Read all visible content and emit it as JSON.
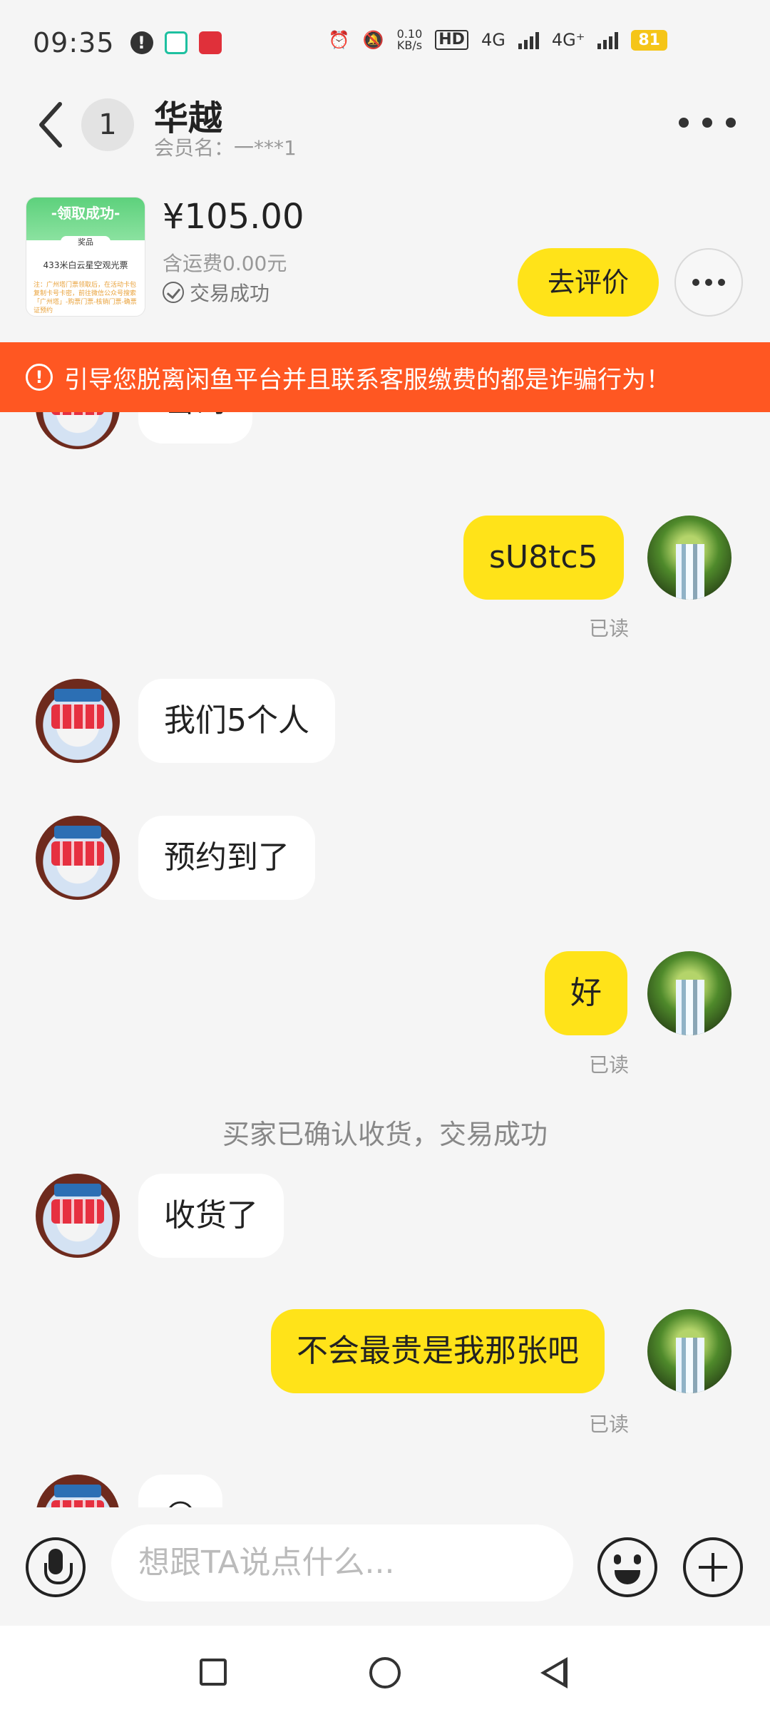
{
  "status_bar": {
    "time": "09:35",
    "net_speed": "0.10",
    "net_speed_unit": "KB/s",
    "hd_label": "HD",
    "sim1_label": "4G",
    "sim2_label": "4G⁺",
    "battery": "81"
  },
  "header": {
    "back_icon": "chevron-left-icon",
    "unread_count": "1",
    "title": "华越",
    "subtitle": "会员名：一***1",
    "more_icon": "more-dots-icon"
  },
  "product": {
    "thumb_banner": "-领取成功-",
    "thumb_tag": "奖品",
    "thumb_text": "433米白云星空观光票",
    "thumb_footer": "注：广州塔门票领取后，在活动卡包复制卡号卡密，前往微信公众号搜索「广州塔」-购票门票-核销门票-确票证预约",
    "price": "¥105.00",
    "shipping": "含运费0.00元",
    "status": "交易成功",
    "review_button": "去评价"
  },
  "warning": {
    "text": "引导您脱离闲鱼平台并且联系客服缴费的都是诈骗行为！"
  },
  "messages": [
    {
      "from": "seller",
      "text": "密码"
    },
    {
      "from": "me",
      "text": "sU8tc5",
      "status": "已读"
    },
    {
      "from": "seller",
      "text": "我们5个人"
    },
    {
      "from": "seller",
      "text": "预约到了"
    },
    {
      "from": "me",
      "text": "好",
      "status": "已读"
    },
    {
      "system": "买家已确认收货，交易成功"
    },
    {
      "from": "seller",
      "text": "收货了"
    },
    {
      "from": "me",
      "text": "不会最贵是我那张吧",
      "status": "已读"
    },
    {
      "from": "seller",
      "text": "😀"
    }
  ],
  "input": {
    "placeholder": "想跟TA说点什么..."
  },
  "colors": {
    "accent": "#ffe319",
    "warning": "#ff5722",
    "background": "#f5f5f5"
  }
}
